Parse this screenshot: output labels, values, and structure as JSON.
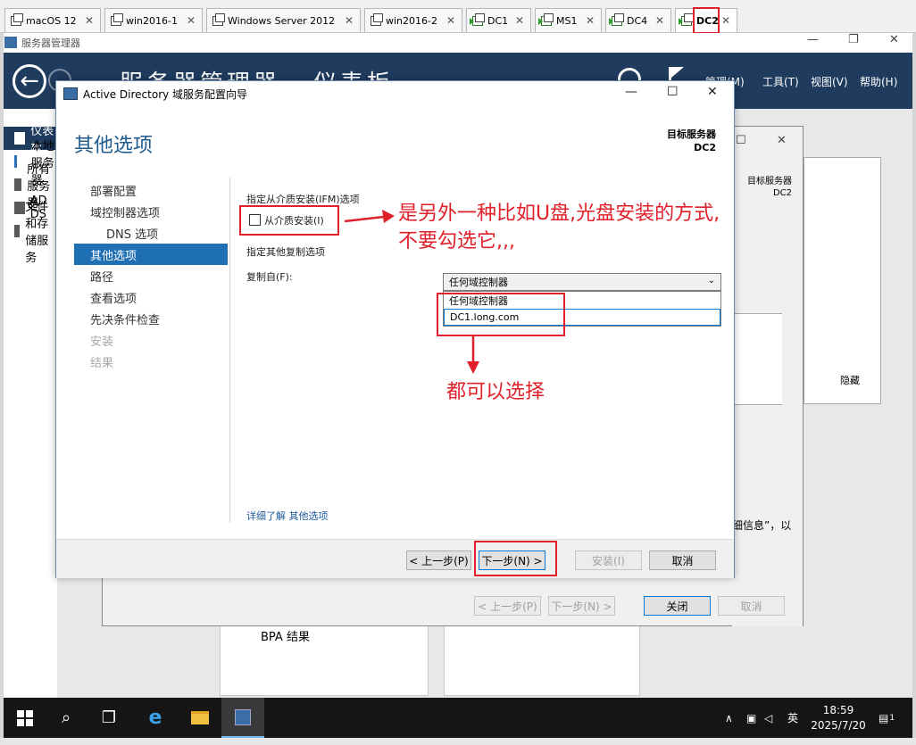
{
  "vm_tabs": [
    {
      "label": "macOS 12",
      "running": false
    },
    {
      "label": "win2016-1",
      "running": false
    },
    {
      "label": "Windows Server 2012",
      "running": false
    },
    {
      "label": "win2016-2",
      "running": false
    },
    {
      "label": "DC1",
      "running": true
    },
    {
      "label": "MS1",
      "running": true
    },
    {
      "label": "DC4",
      "running": true
    },
    {
      "label": "DC2",
      "running": true
    }
  ],
  "server_manager": {
    "title": "服务器管理器",
    "breadcrumb": "服务器管理器 · 仪表板",
    "menus": [
      "管理(M)",
      "工具(T)",
      "视图(V)",
      "帮助(H)"
    ],
    "nav": [
      "仪表板",
      "本地服务器",
      "所有服务器",
      "AD DS",
      "文件和存储服务"
    ],
    "bpa": "BPA 结果"
  },
  "back_dialog": {
    "target_label": "目标服务器",
    "target_name": "DC2",
    "hide": "隐藏",
    "info_text": "细信息”，以",
    "buttons": {
      "prev": "< 上一步(P)",
      "next": "下一步(N) >",
      "close": "关闭",
      "cancel": "取消"
    }
  },
  "wizard": {
    "title": "Active Directory 域服务配置向导",
    "heading": "其他选项",
    "target_label": "目标服务器",
    "target_name": "DC2",
    "steps": [
      {
        "label": "部署配置",
        "state": "normal",
        "sub": false
      },
      {
        "label": "域控制器选项",
        "state": "normal",
        "sub": false
      },
      {
        "label": "DNS 选项",
        "state": "normal",
        "sub": true
      },
      {
        "label": "其他选项",
        "state": "active",
        "sub": false
      },
      {
        "label": "路径",
        "state": "normal",
        "sub": false
      },
      {
        "label": "查看选项",
        "state": "normal",
        "sub": false
      },
      {
        "label": "先决条件检查",
        "state": "normal",
        "sub": false
      },
      {
        "label": "安装",
        "state": "disabled",
        "sub": false
      },
      {
        "label": "结果",
        "state": "disabled",
        "sub": false
      }
    ],
    "ifm_section": "指定从介质安装(IFM)选项",
    "ifm_checkbox": "从介质安装(I)",
    "ifm_checked": false,
    "replication_section": "指定其他复制选项",
    "replicate_from_label": "复制自(F):",
    "replicate_value": "任何域控制器",
    "options": [
      "任何域控制器",
      "DC1.long.com"
    ],
    "learn_more": "详细了解 其他选项",
    "buttons": {
      "prev": "< 上一步(P)",
      "next": "下一步(N) >",
      "install": "安装(I)",
      "cancel": "取消"
    }
  },
  "annotations": {
    "ifm_note_line1": "是另外一种比如U盘,光盘安装的方式,",
    "ifm_note_line2": "不要勾选它,,,",
    "options_note": "都可以选择"
  },
  "taskbar": {
    "ime": "英",
    "time": "18:59",
    "date": "2025/7/20",
    "notifications": "1"
  },
  "colors": {
    "annotation_red": "#e0202a",
    "header_navy": "#1f3b5e",
    "step_active_blue": "#1e6fb4",
    "heading_blue": "#1e5a8e"
  }
}
